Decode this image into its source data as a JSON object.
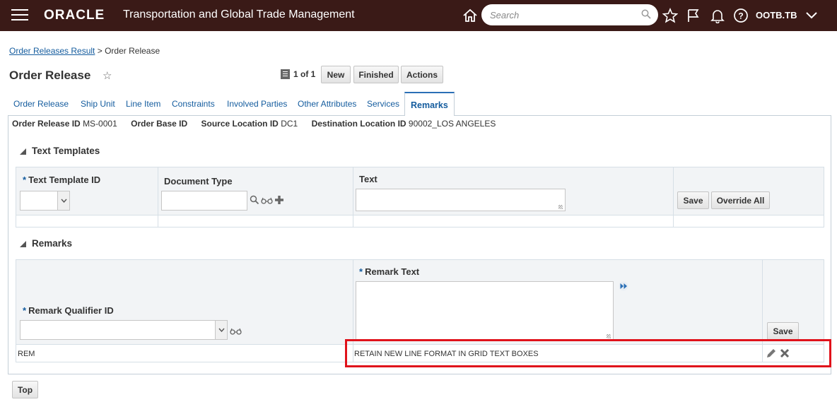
{
  "header": {
    "logo": "ORACLE",
    "app_title": "Transportation and Global Trade Management",
    "search_placeholder": "Search",
    "user": "OOTB.TB"
  },
  "breadcrumb": {
    "link": "Order Releases Result",
    "separator": ">",
    "current": "Order Release"
  },
  "page": {
    "title": "Order Release",
    "pager": "1 of 1",
    "buttons": {
      "new": "New",
      "finished": "Finished",
      "actions": "Actions"
    }
  },
  "tabs": [
    "Order Release",
    "Ship Unit",
    "Line Item",
    "Constraints",
    "Involved Parties",
    "Other Attributes",
    "Services",
    "Remarks"
  ],
  "info": {
    "order_release_id_label": "Order Release ID",
    "order_release_id": "MS-0001",
    "order_base_id_label": "Order Base ID",
    "order_base_id": "",
    "source_location_label": "Source Location ID",
    "source_location": "DC1",
    "destination_location_label": "Destination Location ID",
    "destination_location": "90002_LOS ANGELES"
  },
  "text_templates": {
    "title": "Text Templates",
    "col_template_id": "Text Template ID",
    "col_document_type": "Document Type",
    "col_text": "Text",
    "save": "Save",
    "override_all": "Override All"
  },
  "remarks": {
    "title": "Remarks",
    "col_qualifier": "Remark Qualifier ID",
    "col_text": "Remark Text",
    "save": "Save",
    "rows": [
      {
        "qualifier": "REM",
        "text": "RETAIN NEW LINE FORMAT IN GRID TEXT BOXES"
      }
    ]
  },
  "footer": {
    "top": "Top"
  },
  "colors": {
    "header_bg": "#3a1a17",
    "link": "#145c9e",
    "highlight": "#e0121b"
  }
}
